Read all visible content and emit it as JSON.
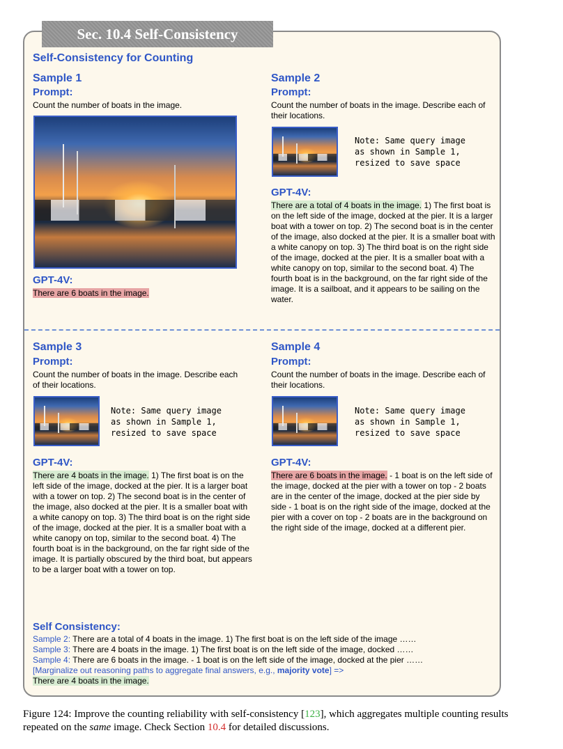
{
  "section_tab": "Sec. 10.4 Self-Consistency",
  "main_title": "Self-Consistency for Counting",
  "note_text": "Note: Same query image\nas shown in Sample 1,\nresized to save space",
  "samples": [
    {
      "title": "Sample 1",
      "prompt_label": "Prompt:",
      "prompt": "Count the number of boats in the image.",
      "gpt_label": "GPT-4V:",
      "answer_highlight": "There are 6 boats in the image.",
      "answer_rest": ""
    },
    {
      "title": "Sample 2",
      "prompt_label": "Prompt:",
      "prompt": "Count the number of boats in the image. Describe each of their locations.",
      "gpt_label": "GPT-4V:",
      "answer_highlight": "There are a total of 4 boats in the image.",
      "answer_rest": " 1) The first boat is on the left side of the image, docked at the pier. It is a larger boat with a tower on top. 2) The second boat is in the center of the image, also docked at the pier. It is a smaller boat with a white canopy on top. 3) The third boat is on the right side of the image, docked at the pier. It is a smaller boat with a white canopy on top, similar to the second boat. 4) The fourth boat is in the background, on the far right side of the image. It is a sailboat, and it appears to be sailing on the water."
    },
    {
      "title": "Sample 3",
      "prompt_label": "Prompt:",
      "prompt": "Count the number of boats in the image. Describe each of their locations.",
      "gpt_label": "GPT-4V:",
      "answer_highlight": "There are 4 boats in the image.",
      "answer_rest": " 1) The first boat is on the left side of the image, docked at the pier. It is a larger boat with a tower on top. 2) The second boat is in the center of the image, also docked at the pier. It is a smaller boat with a white canopy on top. 3) The third boat is on the right side of the image, docked at the pier. It is a smaller boat with a white canopy on top, similar to the second boat. 4) The fourth boat is in the background, on the far right side of the image. It is partially obscured by the third boat, but appears to be a larger boat with a tower on top."
    },
    {
      "title": "Sample 4",
      "prompt_label": "Prompt:",
      "prompt": "Count the number of boats in the image. Describe each of their locations.",
      "gpt_label": "GPT-4V:",
      "answer_highlight": "There are 6 boats in the image.",
      "answer_rest": " - 1 boat is on the left side of the image, docked at the pier with a tower on top - 2 boats are in the center of the image, docked at the pier side by side - 1 boat is on the right side of the image, docked at the pier with a cover on top - 2 boats are in the background on the right side of the image, docked at a different pier."
    }
  ],
  "self_consistency": {
    "title": "Self Consistency:",
    "lines": [
      {
        "label": "Sample 2:",
        "text": " There are a total of 4 boats in the image. 1) The first boat is on the left side of the image ……"
      },
      {
        "label": "Sample 3:",
        "text": " There are 4 boats in the image. 1) The first boat is on the left side of the image, docked ……"
      },
      {
        "label": "Sample 4:",
        "text": " There are 6 boats in the image. - 1 boat is on the left side of the image, docked at the pier ……"
      }
    ],
    "marginalize_prefix": "[Marginalize out reasoning paths to aggregate final answers, e.g., ",
    "marginalize_bold": "majority vote",
    "marginalize_suffix": "] =>",
    "final_answer": "There are 4 boats in the image."
  },
  "caption": {
    "part1": "Figure 124: Improve the counting reliability with self-consistency [",
    "ref1": "123",
    "part2": "], which aggregates multiple counting results repeated on the ",
    "italic": "same",
    "part3": " image. Check Section ",
    "ref2": "10.4",
    "part4": " for detailed discussions."
  },
  "colors": {
    "accent_blue": "#2f56c6",
    "highlight_green": "#d8ecd2",
    "highlight_red": "#e7a5a5",
    "panel_bg": "#fdf8ec"
  }
}
